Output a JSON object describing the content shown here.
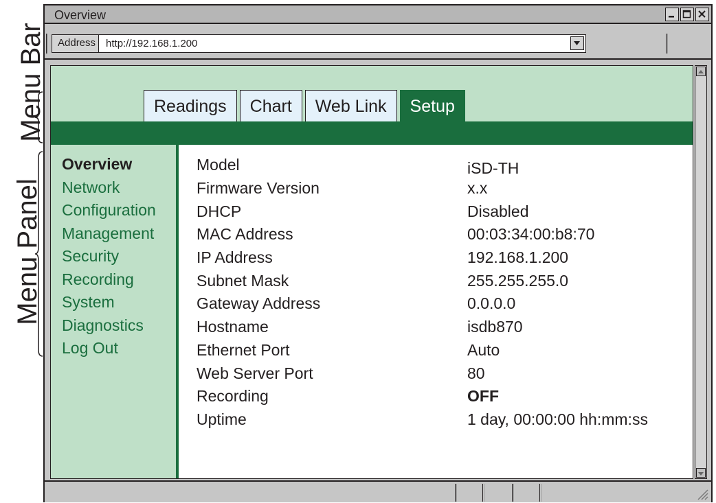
{
  "annotations": {
    "menu_bar": "Menu Bar",
    "menu_panel": "Menu Panel"
  },
  "window": {
    "title": "Overview",
    "buttons": [
      "minimize-icon",
      "maximize-icon",
      "close-icon"
    ]
  },
  "address_bar": {
    "label": "Address",
    "value": "http://192.168.1.200"
  },
  "tabs": [
    {
      "label": "Readings",
      "active": false
    },
    {
      "label": "Chart",
      "active": false
    },
    {
      "label": "Web Link",
      "active": false
    },
    {
      "label": "Setup",
      "active": true
    }
  ],
  "menu": {
    "items": [
      {
        "label": "Overview",
        "current": true
      },
      {
        "label": "Network",
        "current": false
      },
      {
        "label": "Configuration",
        "current": false
      },
      {
        "label": "Management",
        "current": false
      },
      {
        "label": "Security",
        "current": false
      },
      {
        "label": "Recording",
        "current": false
      },
      {
        "label": "System",
        "current": false
      },
      {
        "label": "Diagnostics",
        "current": false
      },
      {
        "label": "Log Out",
        "current": false
      }
    ]
  },
  "overview": {
    "rows": [
      {
        "key": "Model",
        "value": "iSD-TH"
      },
      {
        "key": "Firmware Version",
        "value": "x.x"
      },
      {
        "key": "DHCP",
        "value": "Disabled"
      },
      {
        "key": "MAC Address",
        "value": "00:03:34:00:b8:70"
      },
      {
        "key": "IP Address",
        "value": "192.168.1.200"
      },
      {
        "key": "Subnet Mask",
        "value": "255.255.255.0"
      },
      {
        "key": "Gateway Address",
        "value": "0.0.0.0"
      },
      {
        "key": "Hostname",
        "value": "isdb870"
      },
      {
        "key": "Ethernet Port",
        "value": "Auto"
      },
      {
        "key": "Web Server Port",
        "value": "80"
      },
      {
        "key": "Recording",
        "value": "OFF"
      },
      {
        "key": "Uptime",
        "value": "1 day, 00:00:00 hh:mm:ss"
      }
    ]
  },
  "colors": {
    "brand_green": "#1a6e3e",
    "panel_light_green": "#bfe0c8",
    "tab_light_blue": "#e4f1fa",
    "chrome_gray": "#c6c6c6"
  }
}
